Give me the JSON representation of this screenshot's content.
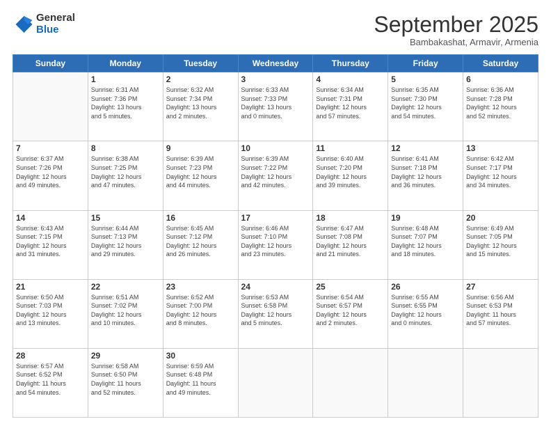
{
  "logo": {
    "general": "General",
    "blue": "Blue"
  },
  "header": {
    "month": "September 2025",
    "location": "Bambakashat, Armavir, Armenia"
  },
  "weekdays": [
    "Sunday",
    "Monday",
    "Tuesday",
    "Wednesday",
    "Thursday",
    "Friday",
    "Saturday"
  ],
  "weeks": [
    [
      {
        "day": "",
        "info": ""
      },
      {
        "day": "1",
        "info": "Sunrise: 6:31 AM\nSunset: 7:36 PM\nDaylight: 13 hours\nand 5 minutes."
      },
      {
        "day": "2",
        "info": "Sunrise: 6:32 AM\nSunset: 7:34 PM\nDaylight: 13 hours\nand 2 minutes."
      },
      {
        "day": "3",
        "info": "Sunrise: 6:33 AM\nSunset: 7:33 PM\nDaylight: 13 hours\nand 0 minutes."
      },
      {
        "day": "4",
        "info": "Sunrise: 6:34 AM\nSunset: 7:31 PM\nDaylight: 12 hours\nand 57 minutes."
      },
      {
        "day": "5",
        "info": "Sunrise: 6:35 AM\nSunset: 7:30 PM\nDaylight: 12 hours\nand 54 minutes."
      },
      {
        "day": "6",
        "info": "Sunrise: 6:36 AM\nSunset: 7:28 PM\nDaylight: 12 hours\nand 52 minutes."
      }
    ],
    [
      {
        "day": "7",
        "info": "Sunrise: 6:37 AM\nSunset: 7:26 PM\nDaylight: 12 hours\nand 49 minutes."
      },
      {
        "day": "8",
        "info": "Sunrise: 6:38 AM\nSunset: 7:25 PM\nDaylight: 12 hours\nand 47 minutes."
      },
      {
        "day": "9",
        "info": "Sunrise: 6:39 AM\nSunset: 7:23 PM\nDaylight: 12 hours\nand 44 minutes."
      },
      {
        "day": "10",
        "info": "Sunrise: 6:39 AM\nSunset: 7:22 PM\nDaylight: 12 hours\nand 42 minutes."
      },
      {
        "day": "11",
        "info": "Sunrise: 6:40 AM\nSunset: 7:20 PM\nDaylight: 12 hours\nand 39 minutes."
      },
      {
        "day": "12",
        "info": "Sunrise: 6:41 AM\nSunset: 7:18 PM\nDaylight: 12 hours\nand 36 minutes."
      },
      {
        "day": "13",
        "info": "Sunrise: 6:42 AM\nSunset: 7:17 PM\nDaylight: 12 hours\nand 34 minutes."
      }
    ],
    [
      {
        "day": "14",
        "info": "Sunrise: 6:43 AM\nSunset: 7:15 PM\nDaylight: 12 hours\nand 31 minutes."
      },
      {
        "day": "15",
        "info": "Sunrise: 6:44 AM\nSunset: 7:13 PM\nDaylight: 12 hours\nand 29 minutes."
      },
      {
        "day": "16",
        "info": "Sunrise: 6:45 AM\nSunset: 7:12 PM\nDaylight: 12 hours\nand 26 minutes."
      },
      {
        "day": "17",
        "info": "Sunrise: 6:46 AM\nSunset: 7:10 PM\nDaylight: 12 hours\nand 23 minutes."
      },
      {
        "day": "18",
        "info": "Sunrise: 6:47 AM\nSunset: 7:08 PM\nDaylight: 12 hours\nand 21 minutes."
      },
      {
        "day": "19",
        "info": "Sunrise: 6:48 AM\nSunset: 7:07 PM\nDaylight: 12 hours\nand 18 minutes."
      },
      {
        "day": "20",
        "info": "Sunrise: 6:49 AM\nSunset: 7:05 PM\nDaylight: 12 hours\nand 15 minutes."
      }
    ],
    [
      {
        "day": "21",
        "info": "Sunrise: 6:50 AM\nSunset: 7:03 PM\nDaylight: 12 hours\nand 13 minutes."
      },
      {
        "day": "22",
        "info": "Sunrise: 6:51 AM\nSunset: 7:02 PM\nDaylight: 12 hours\nand 10 minutes."
      },
      {
        "day": "23",
        "info": "Sunrise: 6:52 AM\nSunset: 7:00 PM\nDaylight: 12 hours\nand 8 minutes."
      },
      {
        "day": "24",
        "info": "Sunrise: 6:53 AM\nSunset: 6:58 PM\nDaylight: 12 hours\nand 5 minutes."
      },
      {
        "day": "25",
        "info": "Sunrise: 6:54 AM\nSunset: 6:57 PM\nDaylight: 12 hours\nand 2 minutes."
      },
      {
        "day": "26",
        "info": "Sunrise: 6:55 AM\nSunset: 6:55 PM\nDaylight: 12 hours\nand 0 minutes."
      },
      {
        "day": "27",
        "info": "Sunrise: 6:56 AM\nSunset: 6:53 PM\nDaylight: 11 hours\nand 57 minutes."
      }
    ],
    [
      {
        "day": "28",
        "info": "Sunrise: 6:57 AM\nSunset: 6:52 PM\nDaylight: 11 hours\nand 54 minutes."
      },
      {
        "day": "29",
        "info": "Sunrise: 6:58 AM\nSunset: 6:50 PM\nDaylight: 11 hours\nand 52 minutes."
      },
      {
        "day": "30",
        "info": "Sunrise: 6:59 AM\nSunset: 6:48 PM\nDaylight: 11 hours\nand 49 minutes."
      },
      {
        "day": "",
        "info": ""
      },
      {
        "day": "",
        "info": ""
      },
      {
        "day": "",
        "info": ""
      },
      {
        "day": "",
        "info": ""
      }
    ]
  ]
}
